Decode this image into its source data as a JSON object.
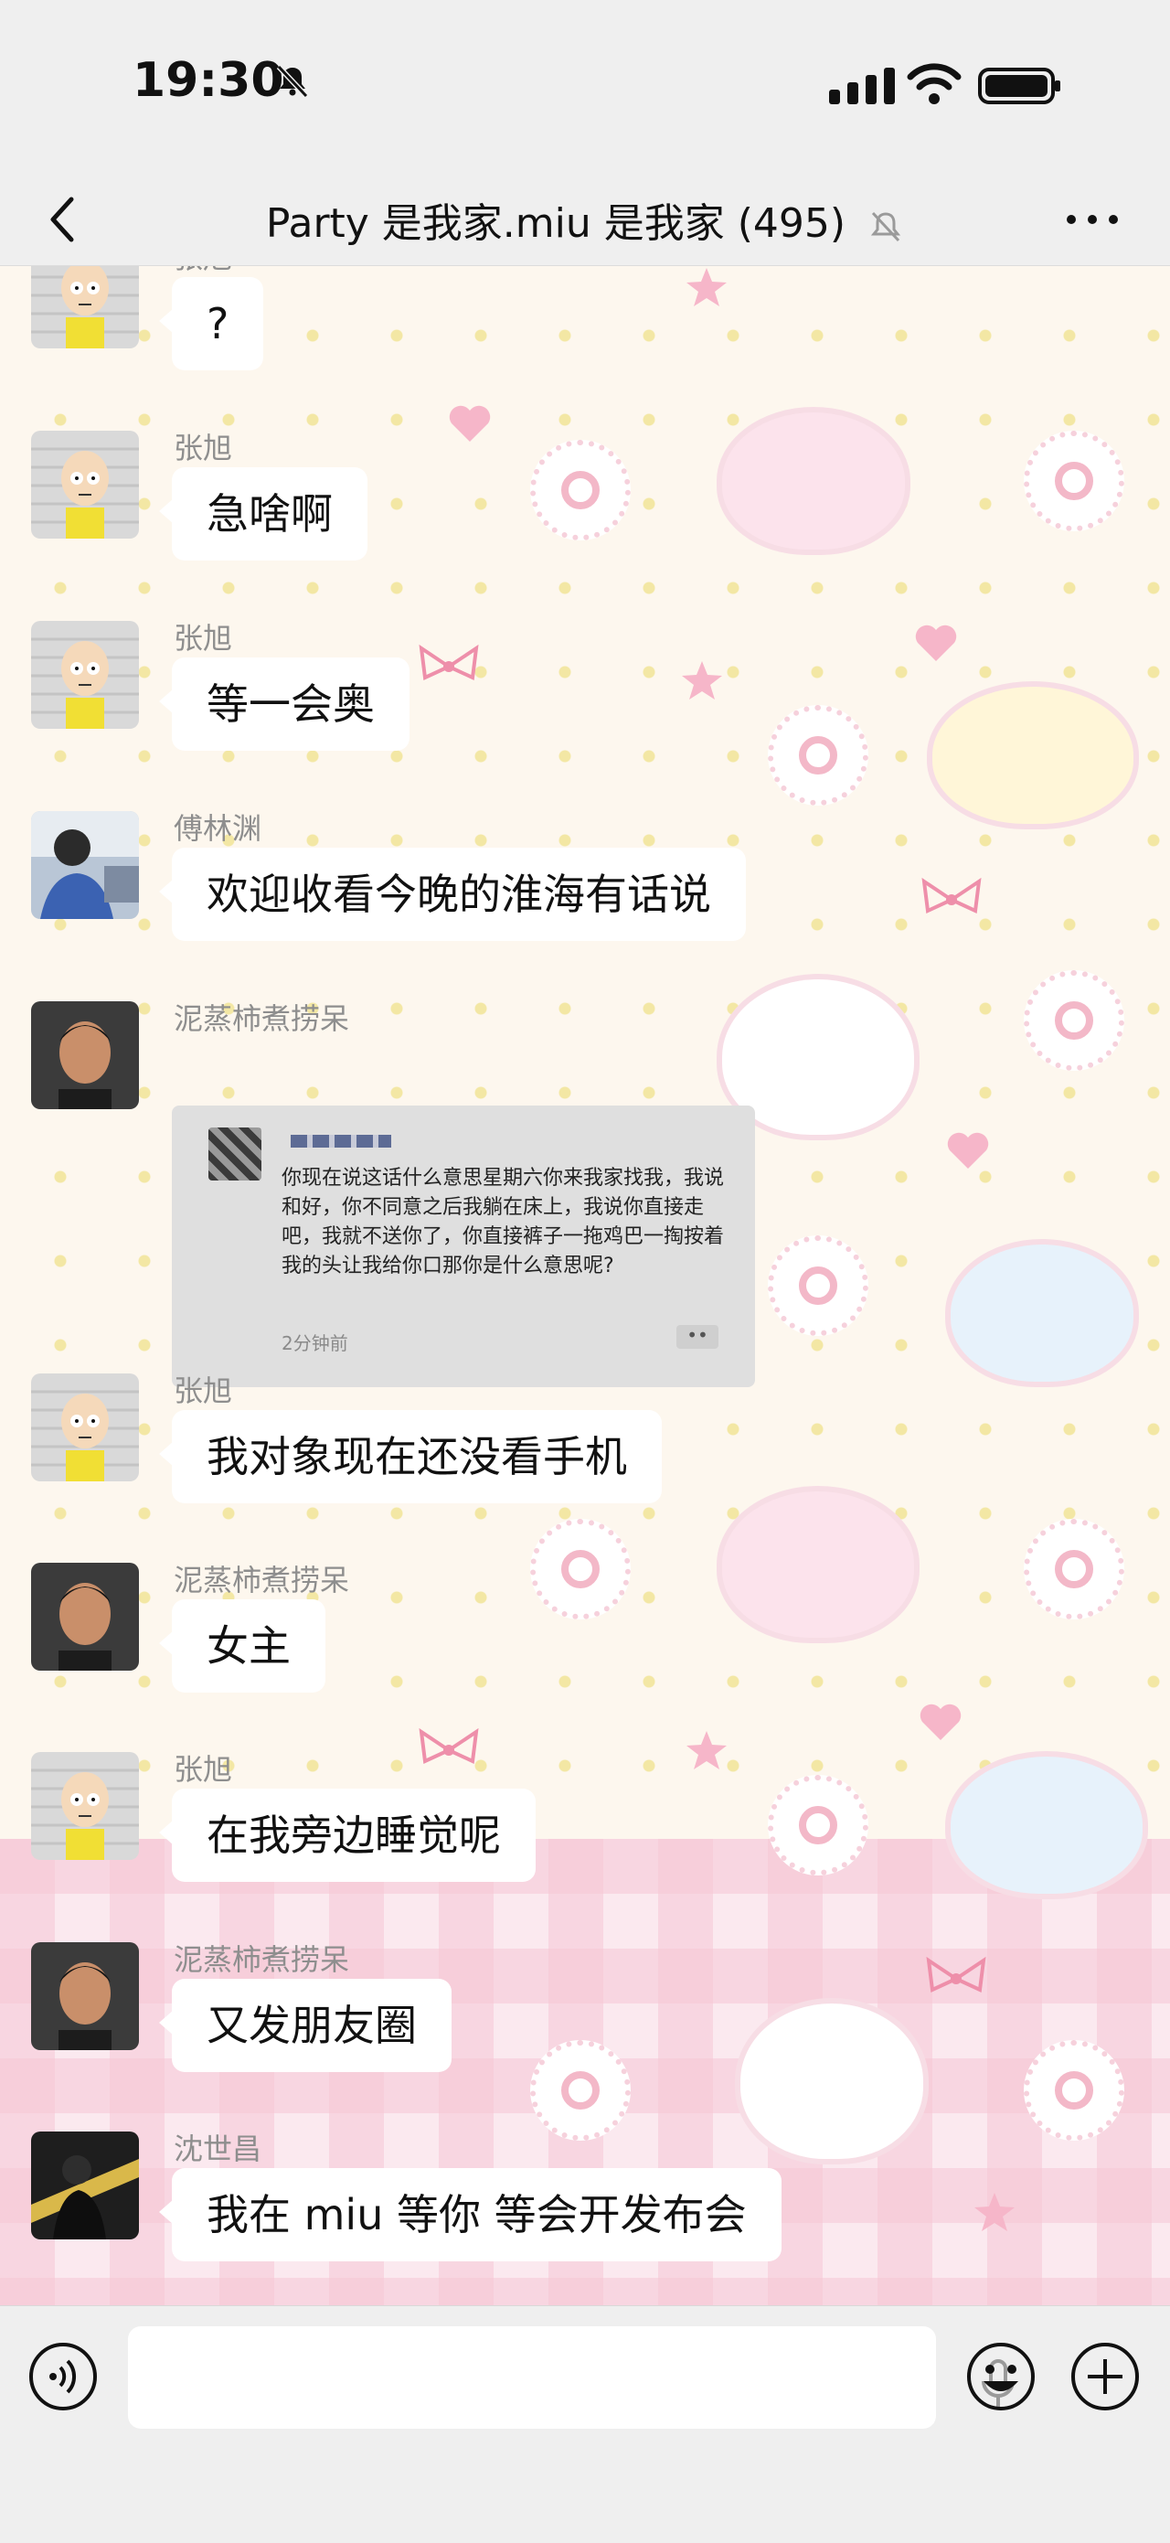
{
  "status": {
    "time": "19:30"
  },
  "header": {
    "title": "Party 是我家.miu 是我家 (495)"
  },
  "messages": [
    {
      "sender": "张旭",
      "text": "?",
      "avatar": "cartoon-yellow"
    },
    {
      "sender": "张旭",
      "text": "急啥啊",
      "avatar": "cartoon-yellow"
    },
    {
      "sender": "张旭",
      "text": "等一会奥",
      "avatar": "cartoon-yellow"
    },
    {
      "sender": "傅林渊",
      "text": "欢迎收看今晚的淮海有话说",
      "avatar": "photo-blue"
    },
    {
      "sender": "泥蒸柿煮捞呆",
      "card": {
        "text": "你现在说这话什么意思星期六你来我家找我，我说和好，你不同意之后我躺在床上，我说你直接走吧，我就不送你了，你直接裤子一拖鸡巴一掏按着我的头让我给你口那你是什么意思呢?",
        "time": "2分钟前",
        "dots": "••"
      },
      "avatar": "photo-dark"
    },
    {
      "sender": "张旭",
      "text": "我对象现在还没看手机",
      "avatar": "cartoon-yellow"
    },
    {
      "sender": "泥蒸柿煮捞呆",
      "text": "女主",
      "avatar": "photo-dark"
    },
    {
      "sender": "张旭",
      "text": "在我旁边睡觉呢",
      "avatar": "cartoon-yellow"
    },
    {
      "sender": "泥蒸柿煮捞呆",
      "text": "又发朋友圈",
      "avatar": "photo-dark"
    },
    {
      "sender": "沈世昌",
      "text": "我在 miu 等你 等会开发布会",
      "avatar": "photo-night"
    }
  ],
  "colors": {
    "wallpaper": "#fdf7ee",
    "bubble": "#ffffff",
    "bar": "#efefef",
    "accent_pink": "#f6c7d5"
  },
  "icons": {
    "back": "chevron-left-icon",
    "more": "more-dots-icon",
    "mute": "bell-off-icon",
    "voice": "voice-icon",
    "emoji": "emoji-icon",
    "plus": "plus-icon",
    "mic": "mic-icon"
  }
}
